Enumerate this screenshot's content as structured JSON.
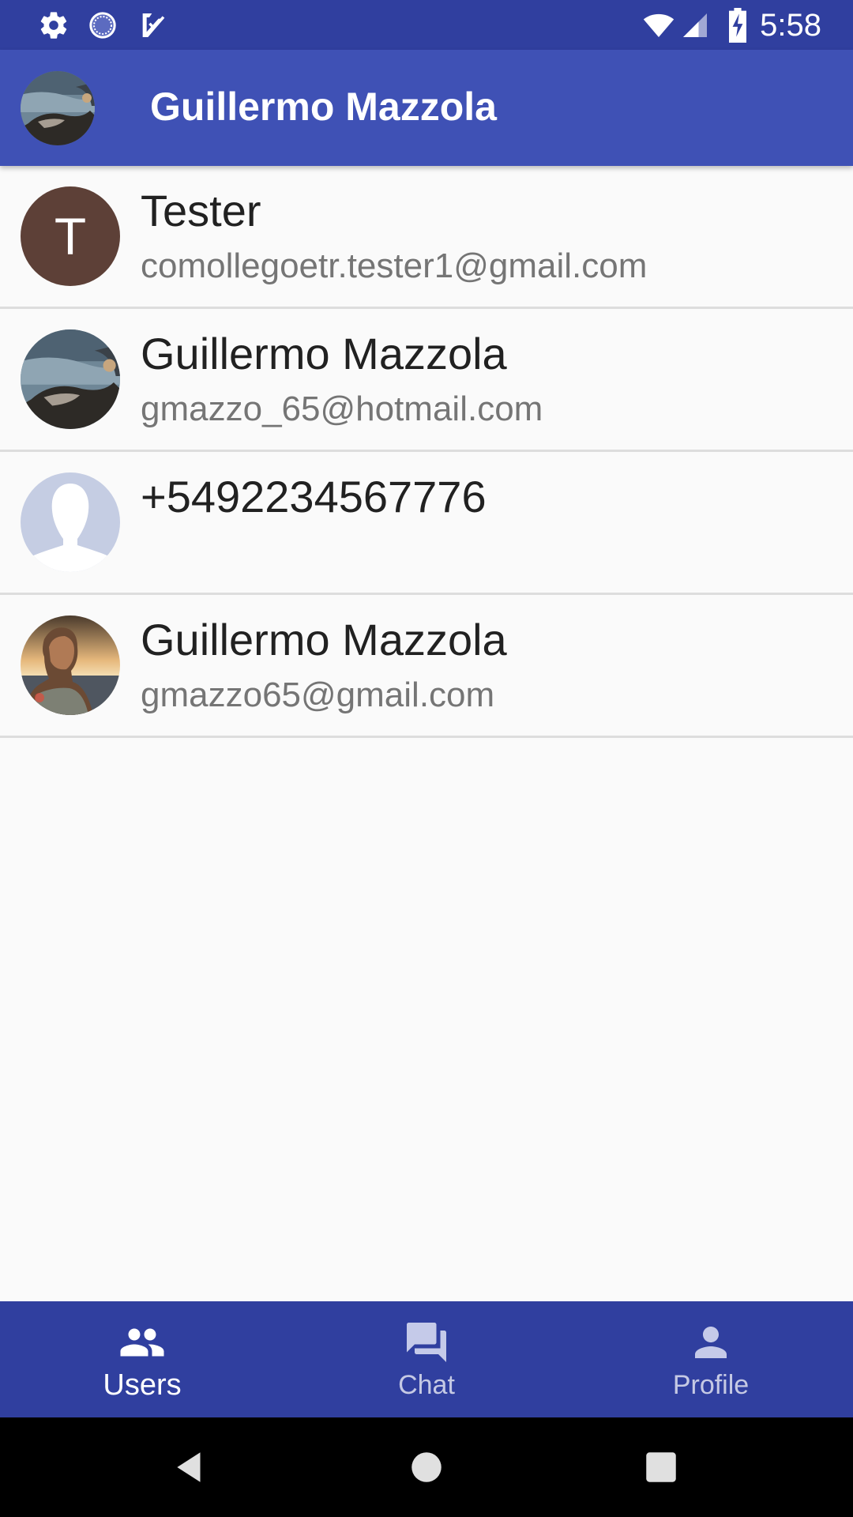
{
  "status_bar": {
    "time": "5:58",
    "left_icons": [
      "settings-icon",
      "sync-icon",
      "task-check-icon"
    ],
    "right_icons": [
      "wifi-icon",
      "signal-icon",
      "battery-charging-icon"
    ]
  },
  "app_bar": {
    "title": "Guillermo Mazzola",
    "avatar": "profile-photo"
  },
  "users": [
    {
      "name": "Tester",
      "email": "comollegoetr.tester1@gmail.com",
      "avatar": "letter-T",
      "letter": "T"
    },
    {
      "name": "Guillermo Mazzola",
      "email": "gmazzo_65@hotmail.com",
      "avatar": "photo-seal"
    },
    {
      "name": "+5492234567776",
      "email": "",
      "avatar": "placeholder-silhouette"
    },
    {
      "name": "Guillermo Mazzola",
      "email": "gmazzo65@gmail.com",
      "avatar": "photo-man-beach"
    }
  ],
  "bottom_nav": {
    "items": [
      {
        "label": "Users",
        "icon": "people-icon",
        "active": true
      },
      {
        "label": "Chat",
        "icon": "forum-icon",
        "active": false
      },
      {
        "label": "Profile",
        "icon": "person-icon",
        "active": false
      }
    ]
  },
  "system_nav": {
    "buttons": [
      "back-icon",
      "home-icon",
      "recents-icon"
    ]
  },
  "colors": {
    "primary": "#3f51b5",
    "primary_dark": "#303f9f",
    "background": "#fafafa",
    "divider": "#dddddd",
    "letter_avatar": "#5d4037",
    "placeholder_avatar": "#c5cde3"
  }
}
